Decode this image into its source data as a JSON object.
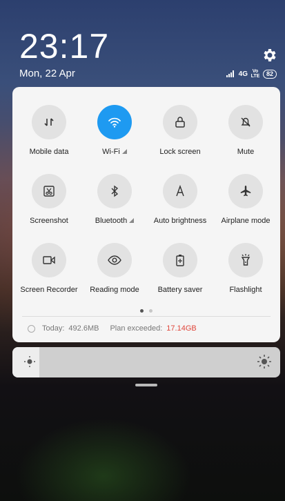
{
  "lockscreen": {
    "time": "23:17",
    "date": "Mon, 22 Apr"
  },
  "status": {
    "network": "4G",
    "volte": "Vo LTE",
    "battery": "82"
  },
  "toggles": [
    {
      "label": "Mobile data",
      "icon": "mobile-data-icon",
      "active": false
    },
    {
      "label": "Wi-Fi",
      "icon": "wifi-icon",
      "active": true
    },
    {
      "label": "Lock screen",
      "icon": "lock-icon",
      "active": false
    },
    {
      "label": "Mute",
      "icon": "bell-off-icon",
      "active": false
    },
    {
      "label": "Screenshot",
      "icon": "screenshot-icon",
      "active": false
    },
    {
      "label": "Bluetooth",
      "icon": "bluetooth-icon",
      "active": false
    },
    {
      "label": "Auto brightness",
      "icon": "auto-brightness-icon",
      "active": false
    },
    {
      "label": "Airplane mode",
      "icon": "airplane-icon",
      "active": false
    },
    {
      "label": "Screen Recorder",
      "icon": "video-camera-icon",
      "active": false
    },
    {
      "label": "Reading mode",
      "icon": "eye-icon",
      "active": false
    },
    {
      "label": "Battery saver",
      "icon": "battery-icon",
      "active": false
    },
    {
      "label": "Flashlight",
      "icon": "flashlight-icon",
      "active": false
    }
  ],
  "data_usage": {
    "today_label": "Today:",
    "today_value": "492.6MB",
    "plan_label": "Plan exceeded:",
    "plan_value": "17.14GB"
  },
  "brightness": {
    "level": 0.1
  },
  "colors": {
    "accent": "#1e9af1",
    "warning": "#e0463b"
  }
}
